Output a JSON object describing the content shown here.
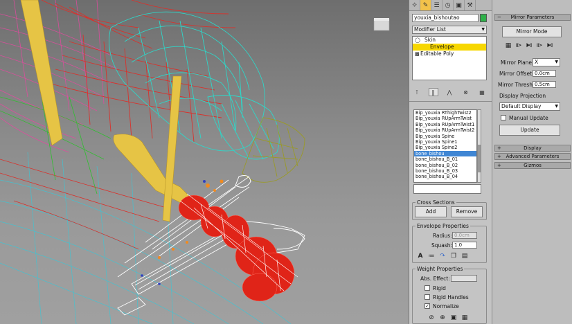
{
  "command_panel": {
    "object_name": "youxia_bishoutao",
    "modifier_list_label": "Modifier List",
    "stack": [
      {
        "label": "Skin",
        "prefix": "○ ▣",
        "selected": false
      },
      {
        "label": "Envelope",
        "prefix": "",
        "selected": true
      },
      {
        "label": "Editable Poly",
        "prefix": "▪",
        "selected": false
      }
    ],
    "bones": [
      "Bip_youxia RThighTwist2",
      "Bip_youxia RUpArmTwist",
      "Bip_youxia RUpArmTwist1",
      "Bip_youxia RUpArmTwist2",
      "Bip_youxia Spine",
      "Bip_youxia Spine1",
      "Bip_youxia Spine2",
      "bone_bishou",
      "bone_bishou_B_01",
      "bone_bishou_B_02",
      "bone_bishou_B_03",
      "bone_bishou_B_04"
    ],
    "selected_bone": "bone_bishou",
    "cross_sections": {
      "title": "Cross Sections",
      "add": "Add",
      "remove": "Remove"
    },
    "envelope_properties": {
      "title": "Envelope Properties",
      "radius_label": "Radius:",
      "radius_value": "0.0cm",
      "squash_label": "Squash:",
      "squash_value": "1.0"
    },
    "weight_properties": {
      "title": "Weight Properties",
      "abs_effect_label": "Abs. Effect:",
      "abs_effect_value": "",
      "rigid": "Rigid",
      "rigid_handles": "Rigid Handles",
      "normalize": "Normalize"
    },
    "colors": {
      "accent": "#f7d700",
      "selection": "#3f86d4",
      "swatch": "#2fb14a"
    }
  },
  "mirror": {
    "header": "Mirror Parameters",
    "mode_button": "Mirror Mode",
    "plane_label": "Mirror Plane:",
    "plane_value": "X",
    "offset_label": "Mirror Offset:",
    "offset_value": "0.0cm",
    "thresh_label": "Mirror Thresh.:",
    "thresh_value": "0.5cm",
    "display_projection_label": "Display Projection",
    "display_projection_value": "Default Display",
    "manual_update": "Manual Update",
    "update_button": "Update"
  },
  "rollouts": [
    {
      "label": "Display",
      "sign": "+"
    },
    {
      "label": "Advanced Parameters",
      "sign": "+"
    },
    {
      "label": "Gizmos",
      "sign": "+"
    }
  ]
}
